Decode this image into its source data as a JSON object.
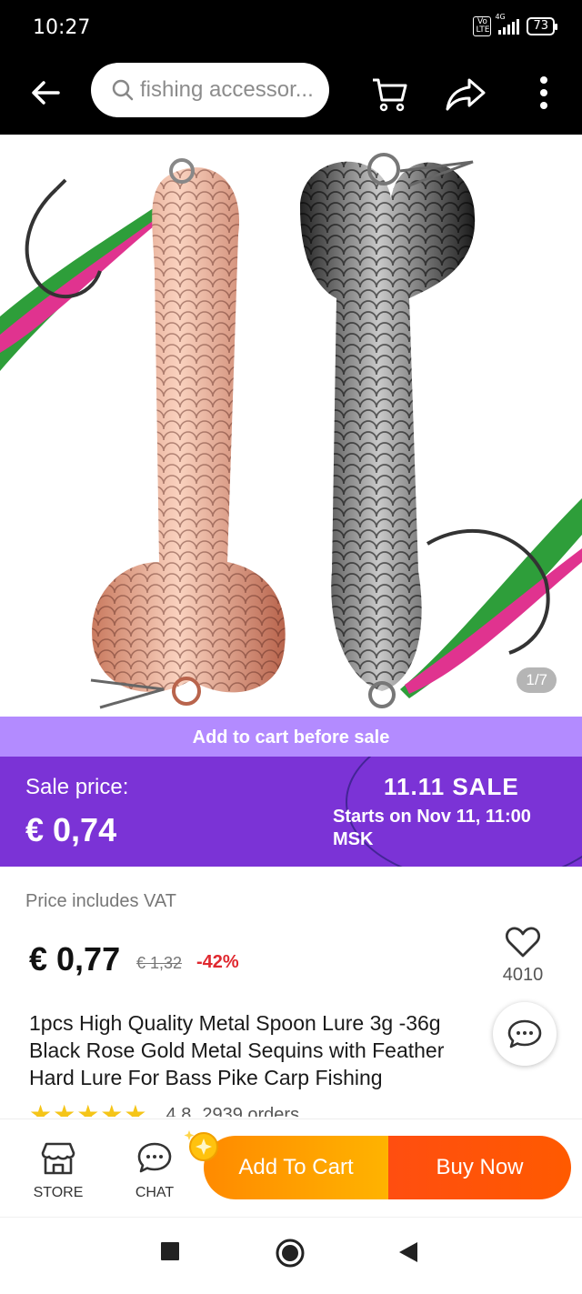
{
  "status": {
    "time": "10:27",
    "volte": "Vo LTE",
    "network": "4G",
    "battery": "73"
  },
  "topbar": {
    "search_placeholder": "fishing accessor..."
  },
  "gallery": {
    "pager": "1/7"
  },
  "promo": {
    "banner": "Add to cart before sale",
    "sale_label": "Sale price:",
    "sale_price": "€ 0,74",
    "event": "11.11 SALE",
    "starts": "Starts on Nov 11, 11:00 MSK"
  },
  "product": {
    "vat_note": "Price includes VAT",
    "price": "€ 0,77",
    "old_price": "€ 1,32",
    "discount": "-42%",
    "favorites": "4010",
    "title": "1pcs High Quality Metal Spoon Lure 3g -36g Black Rose Gold  Metal Sequins with Feather Hard Lure For Bass Pike Carp Fishing",
    "rating": "4.8",
    "orders": "2939 orders"
  },
  "actions": {
    "store": "STORE",
    "chat": "CHAT",
    "add_to_cart": "Add To Cart",
    "buy_now": "Buy Now"
  },
  "colors": {
    "promo_banner": "#b38bff",
    "sale_panel": "#7b33d6",
    "add_cart": "#ffa000",
    "buy_now": "#ff5012",
    "discount": "#e0282f"
  }
}
